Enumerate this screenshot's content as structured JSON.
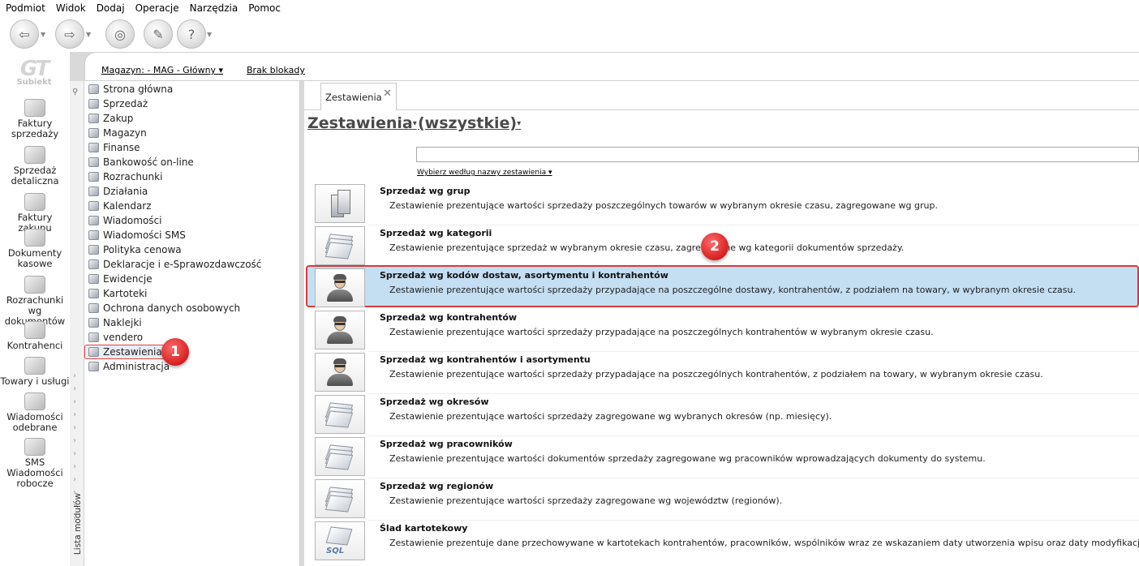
{
  "menu": [
    "Podmiot",
    "Widok",
    "Dodaj",
    "Operacje",
    "Narzędzia",
    "Pomoc"
  ],
  "toolbar_icons": [
    "back-icon",
    "forward-icon",
    "coins-icon",
    "tools-icon",
    "help-icon"
  ],
  "logo": {
    "text": "Subiekt",
    "mark": "GT"
  },
  "left_nav": [
    {
      "label": "Faktury sprzedaży",
      "icon": "invoice-sales-icon"
    },
    {
      "label": "Sprzedaż detaliczna",
      "icon": "retail-icon"
    },
    {
      "label": "Faktury zakupu",
      "icon": "invoice-purchase-icon"
    },
    {
      "label": "Dokumenty kasowe",
      "icon": "cash-docs-icon"
    },
    {
      "label": "Rozrachunki wg dokumentów",
      "icon": "settlements-icon"
    },
    {
      "label": "Kontrahenci",
      "icon": "contractors-icon"
    },
    {
      "label": "Towary i usługi",
      "icon": "goods-icon"
    },
    {
      "label": "Wiadomości odebrane",
      "icon": "messages-icon"
    },
    {
      "label": "SMS Wiadomości robocze",
      "icon": "sms-icon"
    }
  ],
  "header": {
    "warehouse": "Magazyn: - MAG - Główny",
    "lock": "Brak blokady"
  },
  "strip_label": "Lista modułów",
  "modules": [
    "Strona główna",
    "Sprzedaż",
    "Zakup",
    "Magazyn",
    "Finanse",
    "Bankowość on-line",
    "Rozrachunki",
    "Działania",
    "Kalendarz",
    "Wiadomości",
    "Wiadomości SMS",
    "Polityka cenowa",
    "Deklaracje i e-Sprawozdawczość",
    "Ewidencje",
    "Kartoteki",
    "Ochrona danych osobowych",
    "Naklejki",
    "vendero",
    "Zestawienia",
    "Administracja"
  ],
  "active_module": "Zestawienia",
  "tab": {
    "label": "Zestawienia",
    "close": "✕"
  },
  "page": {
    "title": "Zestawienia",
    "filter": "(wszystkie)",
    "search_placeholder": "",
    "filter_by": "Wybierz według nazwy zestawienia"
  },
  "badges": [
    "1",
    "2"
  ],
  "reports": [
    {
      "title": "Sprzedaż wg grup",
      "desc": "Zestawienie prezentujące wartości sprzedaży poszczególnych towarów w wybranym okresie czasu, zagregowane wg grup.",
      "icon": "boxes-icon"
    },
    {
      "title": "Sprzedaż wg kategorii",
      "desc": "Zestawienie prezentujące sprzedaż w wybranym okresie czasu, zagregowane wg kategorii dokumentów sprzedaży.",
      "icon": "stack-icon"
    },
    {
      "title": "Sprzedaż wg kodów dostaw, asortymentu i kontrahentów",
      "desc": "Zestawienie prezentujące wartości sprzedaży przypadające na poszczególne dostawy, kontrahentów, z podziałem na towary, w wybranym okresie czasu.",
      "icon": "person-icon",
      "selected": true
    },
    {
      "title": "Sprzedaż wg kontrahentów",
      "desc": "Zestawienie prezentujące wartości sprzedaży przypadające na poszczególnych kontrahentów w wybranym okresie czasu.",
      "icon": "person-icon"
    },
    {
      "title": "Sprzedaż wg kontrahentów i asortymentu",
      "desc": "Zestawienie prezentujące wartości sprzedaży przypadające na poszczególnych kontrahentów, z podziałem na towary, w wybranym okresie czasu.",
      "icon": "person-icon"
    },
    {
      "title": "Sprzedaż wg okresów",
      "desc": "Zestawienie prezentujące wartości sprzedaży zagregowane wg wybranych okresów (np. miesięcy).",
      "icon": "stack-icon"
    },
    {
      "title": "Sprzedaż wg pracowników",
      "desc": "Zestawienie prezentujące wartości dokumentów sprzedaży zagregowane wg pracowników wprowadzających dokumenty do systemu.",
      "icon": "stack-icon"
    },
    {
      "title": "Sprzedaż wg regionów",
      "desc": "Zestawienie prezentujące wartości sprzedaży zagregowane wg województw (regionów).",
      "icon": "stack-icon"
    },
    {
      "title": "Ślad kartotekowy",
      "desc": "Zestawienie prezentuje dane przechowywane w kartotekach kontrahentów, pracowników, wspólników wraz ze wskazaniem daty utworzenia wpisu oraz daty modyfikacji danych, a",
      "icon": "sql-icon",
      "icon_text": "SQL"
    }
  ]
}
